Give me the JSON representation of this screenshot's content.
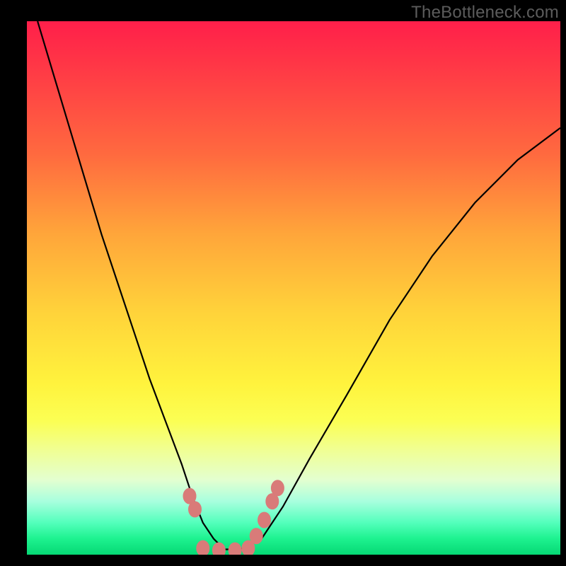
{
  "watermark": "TheBottleneck.com",
  "chart_data": {
    "type": "line",
    "title": "",
    "xlabel": "",
    "ylabel": "",
    "xlim": [
      0,
      100
    ],
    "ylim": [
      0,
      100
    ],
    "grid": false,
    "legend": false,
    "series": [
      {
        "name": "bottleneck-curve",
        "x": [
          2,
          5,
          8,
          11,
          14,
          17,
          20,
          23,
          26,
          29,
          31,
          33,
          35,
          37,
          40,
          44,
          48,
          53,
          60,
          68,
          76,
          84,
          92,
          100
        ],
        "y": [
          100,
          90,
          80,
          70,
          60,
          51,
          42,
          33,
          25,
          17,
          11,
          6,
          3,
          1,
          1,
          3,
          9,
          18,
          30,
          44,
          56,
          66,
          74,
          80
        ]
      }
    ],
    "annotations": [
      {
        "name": "marker-left-upper",
        "x": 30.5,
        "y": 11.0
      },
      {
        "name": "marker-left-lower",
        "x": 31.5,
        "y": 8.5
      },
      {
        "name": "marker-base-1",
        "x": 33.0,
        "y": 1.2
      },
      {
        "name": "marker-base-2",
        "x": 36.0,
        "y": 0.8
      },
      {
        "name": "marker-base-3",
        "x": 39.0,
        "y": 0.8
      },
      {
        "name": "marker-base-4",
        "x": 41.5,
        "y": 1.2
      },
      {
        "name": "marker-right-1",
        "x": 43.0,
        "y": 3.5
      },
      {
        "name": "marker-right-2",
        "x": 44.5,
        "y": 6.5
      },
      {
        "name": "marker-right-3",
        "x": 46.0,
        "y": 10.0
      },
      {
        "name": "marker-right-4",
        "x": 47.0,
        "y": 12.5
      }
    ],
    "background_gradient": {
      "stops": [
        {
          "pos": 0,
          "color": "#ff1f4a"
        },
        {
          "pos": 25,
          "color": "#ff6a3f"
        },
        {
          "pos": 55,
          "color": "#ffd43a"
        },
        {
          "pos": 80,
          "color": "#f1ff8f"
        },
        {
          "pos": 100,
          "color": "#06d874"
        }
      ]
    }
  }
}
